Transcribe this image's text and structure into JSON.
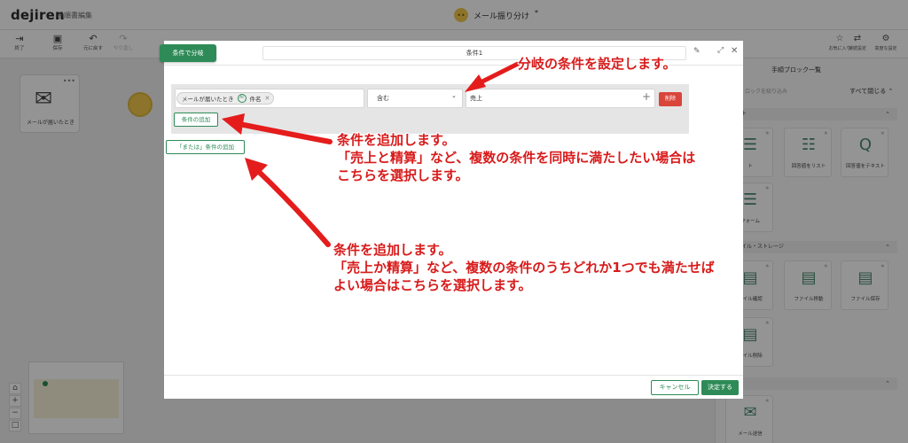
{
  "app": {
    "logo": "dejiren",
    "editor_title": "手順書編集",
    "flow_title": "メール振り分け",
    "flow_title_mark": "*"
  },
  "toolbar": [
    {
      "label": "終了",
      "icon": "exit-icon"
    },
    {
      "label": "保存",
      "icon": "save-icon"
    },
    {
      "label": "元に戻す",
      "icon": "undo-icon"
    },
    {
      "label": "やり直し",
      "icon": "redo-icon"
    }
  ],
  "toolbar_right": [
    {
      "label": "お気に入り",
      "icon": "star-icon"
    },
    {
      "label": "接続設定",
      "icon": "connect-icon"
    },
    {
      "label": "高度な設定",
      "icon": "settings-icon"
    }
  ],
  "canvas": {
    "mail_node_label": "メールが届いたとき"
  },
  "right_panel": {
    "title": "手順ブロック一覧",
    "search_placeholder": "ロックを絞り込み",
    "collapse_all": "すべて閉じる",
    "sections": [
      {
        "label": "ト"
      },
      {
        "label": "イル・ストレージ"
      },
      {
        "label": ""
      }
    ],
    "tiles": [
      {
        "label": "ト",
        "icon": "form-icon"
      },
      {
        "label": "回答値をリスト",
        "icon": "list-icon"
      },
      {
        "label": "回答値をテキスト",
        "icon": "qa-icon"
      },
      {
        "label": "フォーム",
        "icon": "form-icon"
      },
      {
        "label": "ァイル確認",
        "icon": "file-icon"
      },
      {
        "label": "ファイル移動",
        "icon": "file-move-icon"
      },
      {
        "label": "ファイル保存",
        "icon": "file-save-icon"
      },
      {
        "label": "ァイル削除",
        "icon": "file-delete-icon"
      },
      {
        "label": "メール送信",
        "icon": "mail-send-icon"
      }
    ]
  },
  "modal": {
    "branch_button": "条件で分岐",
    "condition_name": "条件1",
    "condition_row": {
      "field_chip_source": "メールが届いたとき",
      "field_chip_ai_badge": "AI",
      "field_chip_name": "件名",
      "operator": "含む",
      "value": "売上",
      "delete_label": "削除"
    },
    "add_condition_label": "条件の追加",
    "add_or_condition_label": "「または」条件の追加",
    "cancel_label": "キャンセル",
    "confirm_label": "決定する"
  },
  "annotations": [
    {
      "lines": [
        "分岐の条件を設定します。"
      ]
    },
    {
      "lines": [
        "条件を追加します。",
        "「売上と精算」など、複数の条件を同時に満たしたい場合は",
        "こちらを選択します。"
      ]
    },
    {
      "lines": [
        "条件を追加します。",
        "「売上か精算」など、複数の条件のうちどれか1つでも満たせば",
        "よい場合はこちらを選択します。"
      ]
    }
  ],
  "colors": {
    "brand_green": "#2e8b57",
    "delete_red": "#d9453b",
    "annotation_red": "#d81b1b",
    "overlay": "rgba(0,0,0,0.42)"
  }
}
